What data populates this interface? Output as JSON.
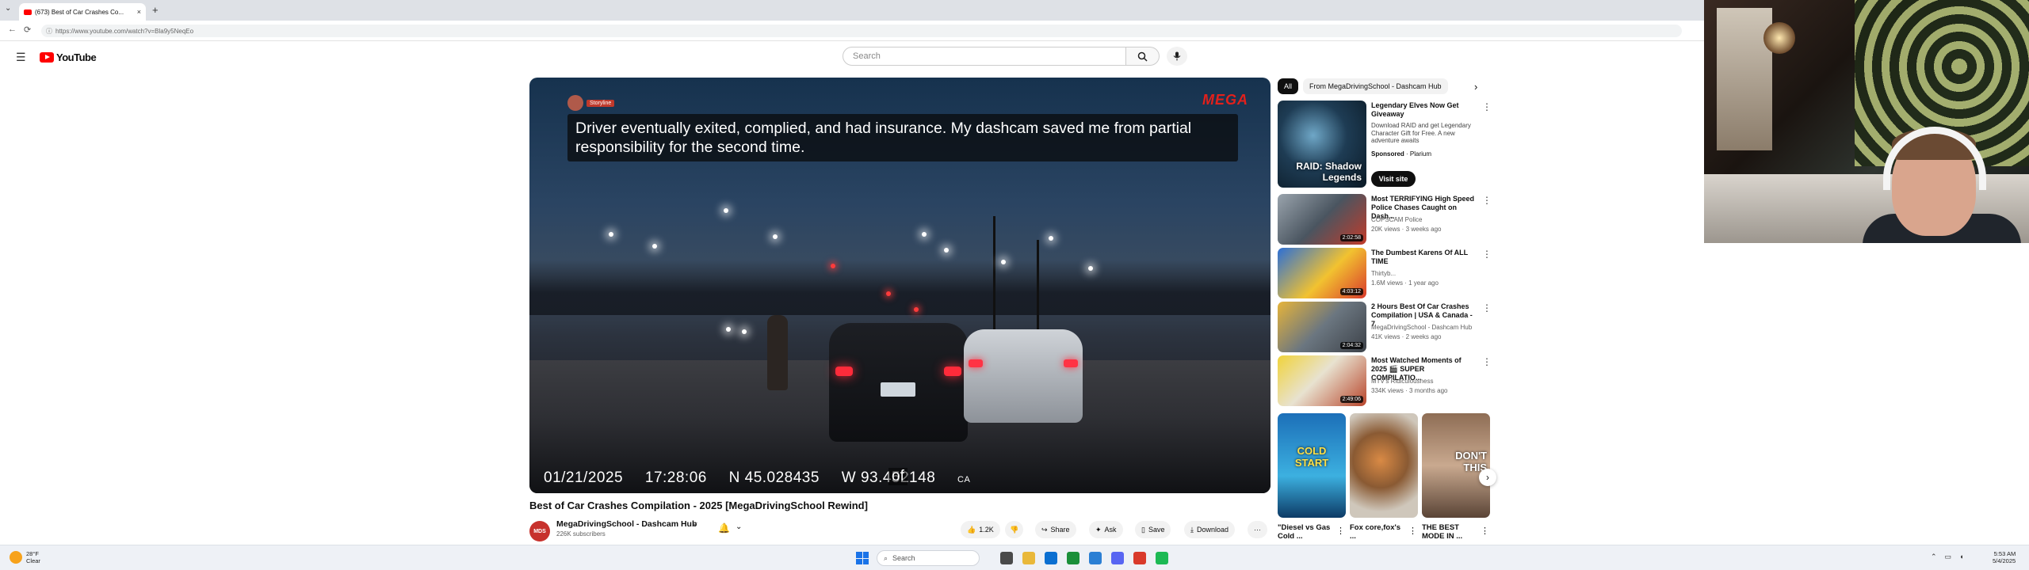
{
  "browser": {
    "tab_title": "(673) Best of Car Crashes Co...",
    "tab_close": "×",
    "new_tab": "+",
    "tab_dropdown": "⌄",
    "url": "https://www.youtube.com/watch?v=Bla9y5NeqEo",
    "nav_back": "←",
    "nav_reload": "⟳"
  },
  "header": {
    "logo_text": "YouTube",
    "search_placeholder": "Search"
  },
  "video": {
    "caption_badge": "Storyline",
    "caption": "Driver eventually exited, complied, and had insurance. My dashcam saved me from partial responsibility for the second time.",
    "overlay_logo": "MEGA",
    "stamp_date": "01/21/2025",
    "stamp_time": "17:28:06",
    "stamp_lat": "N 45.028435",
    "stamp_lon": "W 93.452148",
    "stamp_suffix": "CA",
    "cc_partial": "of",
    "title": "Best of Car Crashes Compilation - 2025 [MegaDrivingSchool Rewind]",
    "channel_avatar_text": "MDS",
    "channel": "MegaDrivingSchool - Dashcam Hub",
    "subscribers": "226K subscribers",
    "actions": {
      "like": "1.2K",
      "share": "Share",
      "ask": "Ask",
      "save": "Save",
      "download": "Download",
      "more": "···"
    }
  },
  "sidebar": {
    "chips": [
      "All",
      "From MegaDrivingSchool - Dashcam Hub"
    ],
    "ad": {
      "thumb_text": "RAID: Shadow Legends",
      "title": "Legendary Elves Now Get Giveaway",
      "description": "Download RAID and get Legendary Character Gift for Free. A new adventure awaits",
      "sponsored": "Sponsored",
      "advertiser": "Plarium",
      "cta": "Visit site"
    },
    "recommendations": [
      {
        "title": "Most TERRIFYING High Speed Police Chases Caught on Dash...",
        "channel": "COPSCAM Police",
        "meta": "20K views · 3 weeks ago",
        "duration": "2:02:58"
      },
      {
        "title": "The Dumbest Karens Of ALL TIME",
        "channel": "Thirtyb...",
        "meta": "1.6M views · 1 year ago",
        "duration": "4:03:12"
      },
      {
        "title": "2 Hours Best Of Car Crashes Compilation | USA & Canada - 7",
        "channel": "MegaDrivingSchool - Dashcam Hub",
        "meta": "41K views · 2 weeks ago",
        "duration": "2:04:32"
      },
      {
        "title": "Most Watched Moments of 2025 🎬 SUPER COMPILATIO...",
        "channel": "MTV's Ridiculousness",
        "meta": "334K views · 3 months ago",
        "duration": "2:49:06"
      }
    ],
    "shorts": [
      {
        "title": "\"Diesel vs Gas Cold ...",
        "thumb_text": "COLD START"
      },
      {
        "title": "Fox core,fox's ...",
        "thumb_text": ""
      },
      {
        "title": "THE BEST MODE IN ...",
        "thumb_text": "DON'T THIS"
      }
    ]
  },
  "taskbar": {
    "weather_temp": "28°F",
    "weather_desc": "Clear",
    "search_label": "Search",
    "time": "5:53 AM",
    "date": "5/4/2025"
  }
}
